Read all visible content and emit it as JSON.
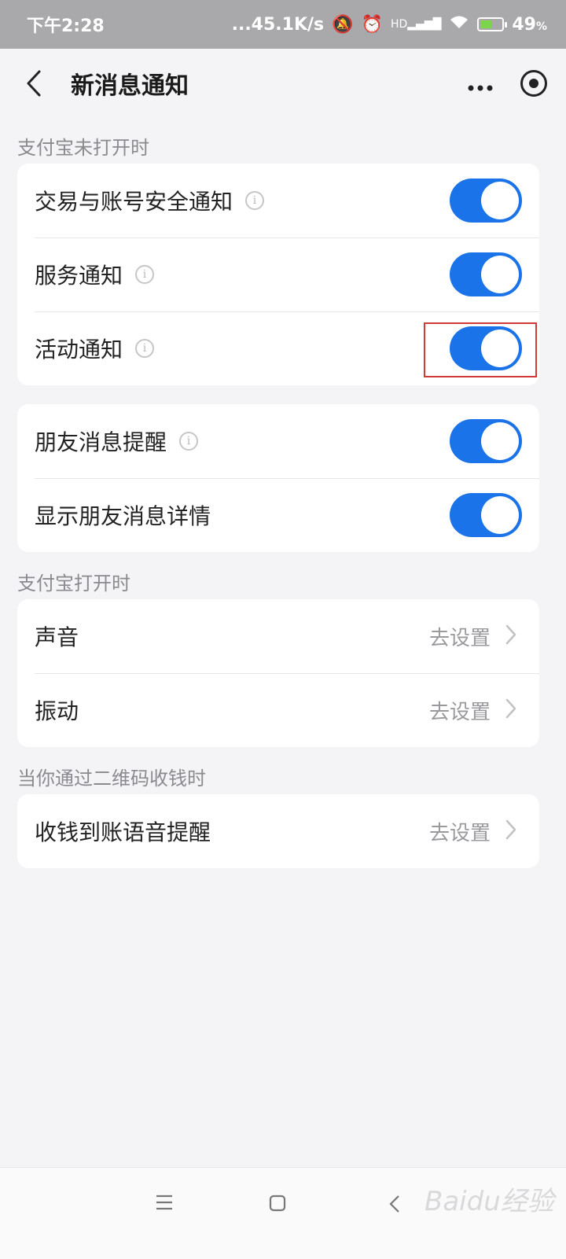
{
  "status_bar": {
    "time": "下午2:28",
    "network_speed": "...45.1K/s",
    "hd_label": "HD",
    "battery_percent": "49",
    "battery_unit": "%"
  },
  "header": {
    "title": "新消息通知",
    "more_icon": "more-icon",
    "target_icon": "target-icon"
  },
  "section_closed": {
    "label": "支付宝未打开时",
    "items": [
      {
        "label": "交易与账号安全通知",
        "has_info": true,
        "enabled": true
      },
      {
        "label": "服务通知",
        "has_info": true,
        "enabled": true
      },
      {
        "label": "活动通知",
        "has_info": true,
        "enabled": true
      }
    ]
  },
  "section_friends": {
    "items": [
      {
        "label": "朋友消息提醒",
        "has_info": true,
        "enabled": true
      },
      {
        "label": "显示朋友消息详情",
        "has_info": false,
        "enabled": true
      }
    ]
  },
  "section_open": {
    "label": "支付宝打开时",
    "items": [
      {
        "label": "声音",
        "action": "去设置"
      },
      {
        "label": "振动",
        "action": "去设置"
      }
    ]
  },
  "section_qr": {
    "label": "当你通过二维码收钱时",
    "items": [
      {
        "label": "收钱到账语音提醒",
        "action": "去设置"
      }
    ]
  },
  "info_glyph": "i",
  "watermark": "Baidu经验",
  "colors": {
    "toggle_on": "#1a73e8",
    "highlight": "#d23a3a",
    "background": "#f4f4f6"
  }
}
